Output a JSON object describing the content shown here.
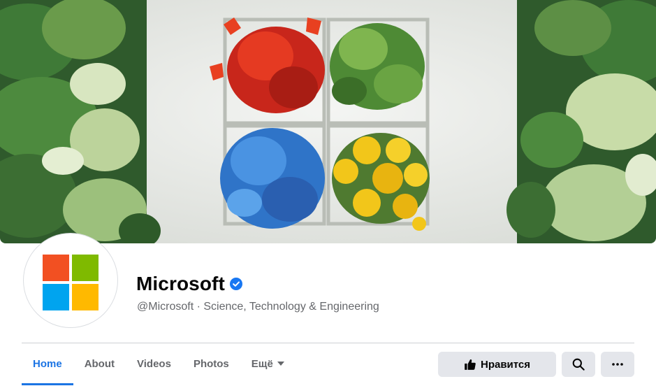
{
  "page": {
    "name": "Microsoft",
    "handle_category": "@Microsoft · Science, Technology & Engineering"
  },
  "cover": {
    "description_icons": [
      "red-flowers",
      "green-herbs",
      "blue-flowers",
      "yellow-flowers"
    ]
  },
  "logo": {
    "colors": [
      "#f25022",
      "#7fba00",
      "#00a4ef",
      "#ffb900"
    ]
  },
  "tabs": [
    {
      "label": "Home",
      "active": true
    },
    {
      "label": "About"
    },
    {
      "label": "Videos"
    },
    {
      "label": "Photos"
    },
    {
      "label": "Ещё"
    }
  ],
  "actions": {
    "like_label": "Нравится",
    "search_icon": "search-icon",
    "more_icon": "more-icon"
  },
  "colors": {
    "accent": "#1b74e4",
    "verified": "#1877f2",
    "button_bg": "#e4e6eb",
    "muted_text": "#65676b"
  }
}
